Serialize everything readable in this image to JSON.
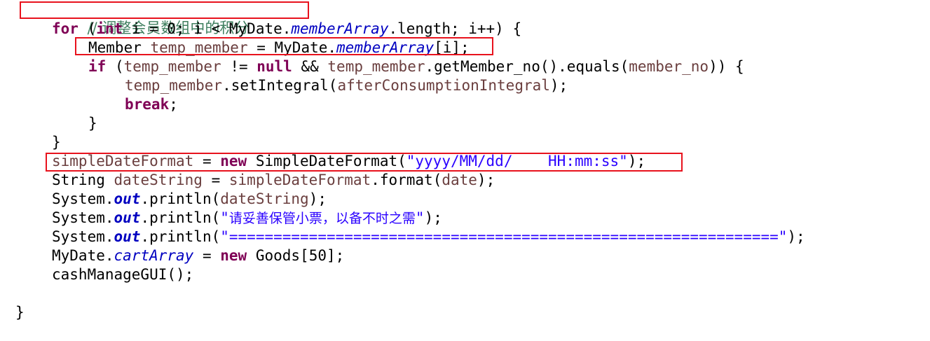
{
  "lines": {
    "comment": {
      "text": "// 调整会员数组中的积分"
    },
    "for_stmt": {
      "kw_for": "for",
      "p1": " (",
      "kw_int": "int",
      "p2": " i = 0; i < MyDate.",
      "field": "memberArray",
      "p3": ".length; i++) {"
    },
    "member_decl": {
      "type": "Member",
      "sp": " ",
      "var": "temp_member",
      "p1": " = MyDate.",
      "field": "memberArray",
      "p2": "[i];"
    },
    "if_stmt": {
      "kw_if": "if",
      "p1": " (",
      "var1": "temp_member",
      "p2": " != ",
      "kw_null": "null",
      "p3": " && ",
      "var2": "temp_member",
      "p4": ".getMember_no().equals(",
      "var3": "member_no",
      "p5": ")) {"
    },
    "set_integral": {
      "var1": "temp_member",
      "p1": ".setIntegral(",
      "var2": "afterConsumptionIntegral",
      "p2": ");"
    },
    "break_stmt": {
      "kw_break": "break",
      "p1": ";"
    },
    "close_if": {
      "text": "}"
    },
    "close_for": {
      "text": "}"
    },
    "sdf_assign": {
      "var": "simpleDateFormat",
      "p1": " = ",
      "kw_new": "new",
      "p2": " SimpleDateFormat(",
      "str": "\"yyyy/MM/dd/    HH:mm:ss\"",
      "p3": ");"
    },
    "date_string": {
      "type": "String",
      "sp": " ",
      "var1": "dateString",
      "p1": " = ",
      "var2": "simpleDateFormat",
      "p2": ".format(",
      "var3": "date",
      "p3": ");"
    },
    "println1": {
      "p0": "System.",
      "out": "out",
      "p1": ".println(",
      "var": "dateString",
      "p2": ");"
    },
    "println2": {
      "p0": "System.",
      "out": "out",
      "p1": ".println(",
      "q1": "\"",
      "cjk": "请妥善保管小票，以备不时之需",
      "q2": "\"",
      "p2": ");"
    },
    "println3": {
      "p0": "System.",
      "out": "out",
      "p1": ".println(",
      "str": "\"==============================================================\"",
      "p2": ");"
    },
    "cart_array": {
      "p0": "MyDate.",
      "field": "cartArray",
      "p1": " = ",
      "kw_new": "new",
      "p2": " Goods[50];"
    },
    "cash_gui": {
      "text": "cashManageGUI();"
    },
    "close_method": {
      "text": "}"
    }
  },
  "colors": {
    "keyword": "#7f0055",
    "local_variable": "#6a3e3e",
    "field": "#0000c0",
    "string": "#2a00ff",
    "comment": "#3f7f5f",
    "highlight_border": "#e8121d"
  }
}
